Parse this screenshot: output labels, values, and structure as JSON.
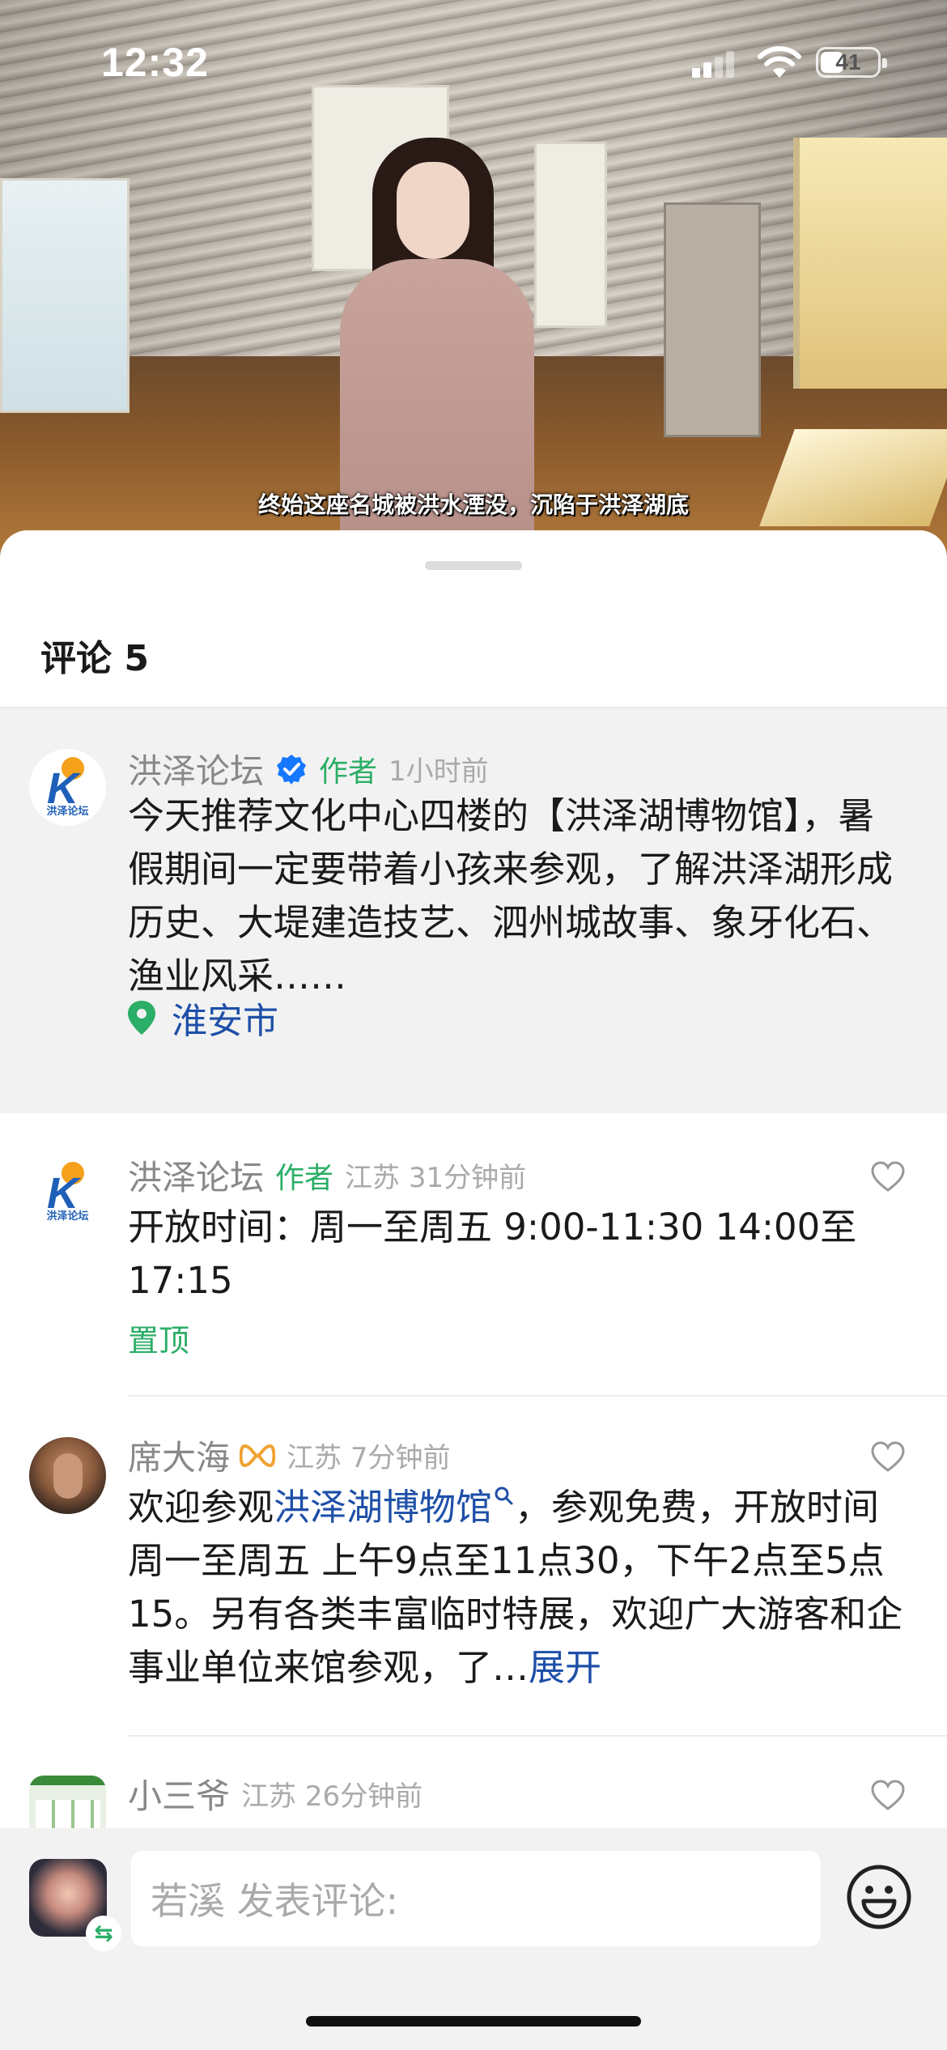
{
  "status_bar": {
    "time": "12:32",
    "battery": "41",
    "battery_level": 0.41
  },
  "video": {
    "subtitle": "终始这座名城被洪水湮没，沉陷于洪泽湖底"
  },
  "comments_panel": {
    "title": "评论 5"
  },
  "comments": [
    {
      "name": "洪泽论坛",
      "verified": true,
      "author_tag": "作者",
      "meta": "1小时前",
      "text": "今天推荐文化中心四楼的【洪泽湖博物馆】，暑假期间一定要带着小孩来参观，了解洪泽湖形成历史、大堤建造技艺、泗州城故事、象牙化石、渔业风采……",
      "location": "淮安市",
      "avatar_caption": "洪泽论坛",
      "icons": [
        "verified-badge-icon",
        "location-pin-icon"
      ]
    },
    {
      "name": "洪泽论坛",
      "author_tag": "作者",
      "meta": "江苏 31分钟前",
      "text": "开放时间：周一至周五 9:00-11:30  14:00至17:15",
      "pinned_label": "置顶",
      "avatar_caption": "洪泽论坛"
    },
    {
      "name": "席大海",
      "meta": "江苏 7分钟前",
      "text_prefix": "欢迎参观",
      "link_text": "洪泽湖博物馆",
      "text_suffix": "，参观免费，开放时间周一至周五 上午9点至11点30，下午2点至5点15。另有各类丰富临时特展，欢迎广大游客和企事业单位来馆参观，了…",
      "expand_label": "展开"
    },
    {
      "name": "小三爷",
      "meta": "江苏 26分钟前"
    }
  ],
  "input_bar": {
    "placeholder": "若溪 发表评论:",
    "swap_icon": "⇆"
  },
  "colors": {
    "author_green": "#2bae67",
    "link_blue": "#1e4fa8",
    "verified_blue": "#1677ff",
    "vip_orange": "#f0a230"
  }
}
